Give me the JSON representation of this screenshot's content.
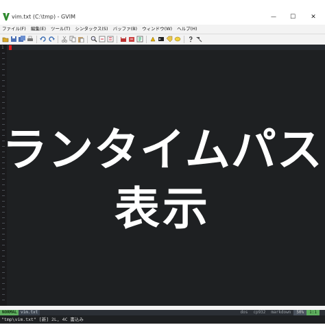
{
  "window": {
    "title": "vim.txt (C:\\tmp) - GVIM",
    "minimize_glyph": "—",
    "maximize_glyph": "☐",
    "close_glyph": "✕"
  },
  "menu": {
    "items": [
      "ファイル(F)",
      "編集(E)",
      "ツール(T)",
      "シンタックス(S)",
      "バッファ(B)",
      "ウィンドウ(W)",
      "ヘルプ(H)"
    ]
  },
  "toolbar": {
    "icons": [
      "open-icon",
      "save-icon",
      "save-all-icon",
      "print-icon",
      "undo-icon",
      "redo-icon",
      "cut-icon",
      "copy-icon",
      "paste-icon",
      "find-icon",
      "find-next-icon",
      "find-prev-icon",
      "load-session-icon",
      "save-session-icon",
      "run-script-icon",
      "make-icon",
      "shell-icon",
      "tags-icon",
      "jump-tag-icon",
      "help-icon",
      "find-help-icon"
    ]
  },
  "editor": {
    "line_number": "1",
    "overlay_line1": "ランタイムパス",
    "overlay_line2": "表示",
    "background": "#1e2022",
    "cursor_color": "#e21d1d"
  },
  "statusline": {
    "mode": "NORMAL",
    "file": "vim.txt",
    "fileformat": "dos",
    "encoding": "cp932",
    "filetype": "markdown",
    "percent": "50%",
    "position": "1:1"
  },
  "cmdline": {
    "message": "\"tmp\\vim.txt\" [新] 2L, 4C 書込み"
  }
}
